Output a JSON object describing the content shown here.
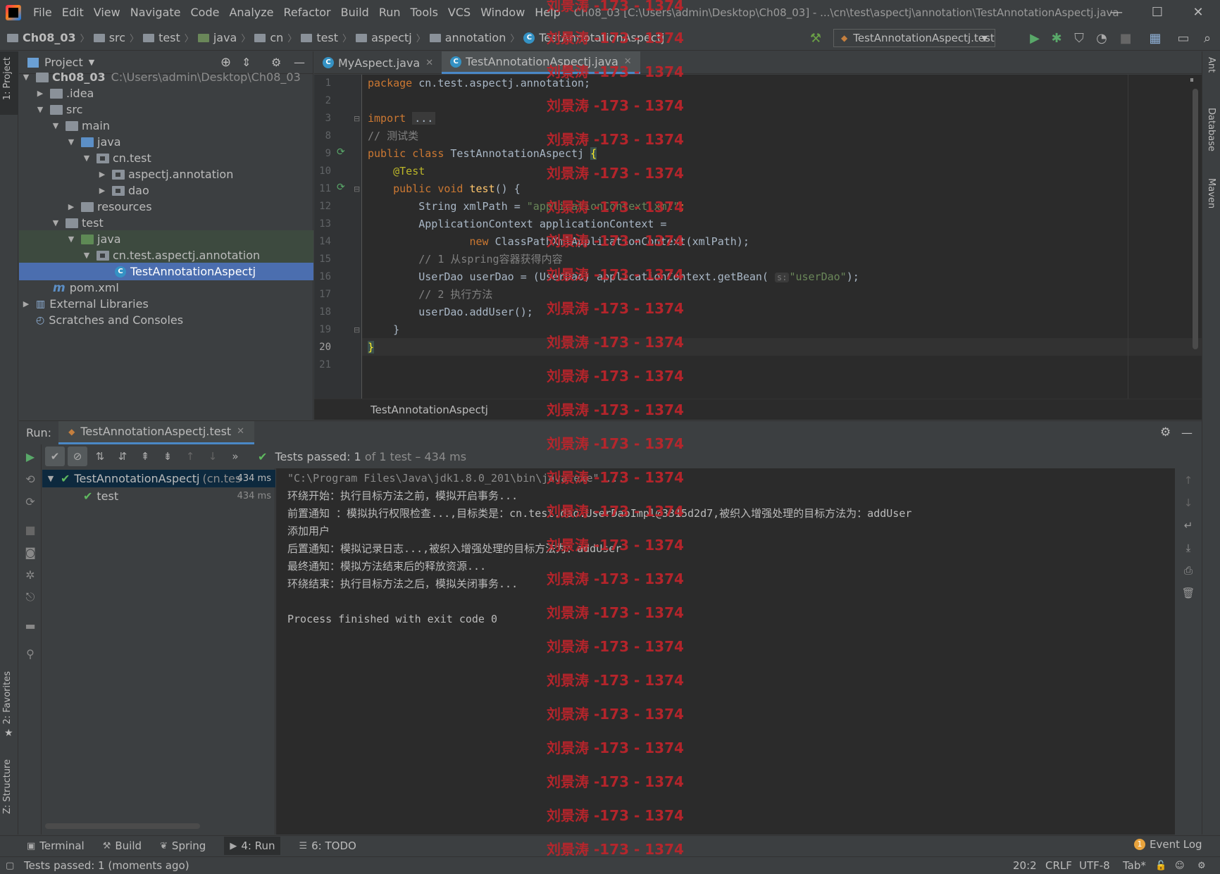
{
  "menu": {
    "items": [
      "File",
      "Edit",
      "View",
      "Navigate",
      "Code",
      "Analyze",
      "Refactor",
      "Build",
      "Run",
      "Tools",
      "VCS",
      "Window",
      "Help"
    ],
    "window_title": "Ch08_03 [C:\\Users\\admin\\Desktop\\Ch08_03] - ...\\cn\\test\\aspectj\\annotation\\TestAnnotationAspectj.java"
  },
  "window_controls": {
    "minimize": "—",
    "maximize": "☐",
    "close": "✕"
  },
  "navbar": {
    "crumbs": [
      "Ch08_03",
      "src",
      "test",
      "java",
      "cn",
      "test",
      "aspectj",
      "annotation",
      "TestAnnotationAspectj"
    ],
    "run_config": "TestAnnotationAspectj.test"
  },
  "left_stripe": {
    "project": "1: Project",
    "favorites": "2: Favorites",
    "structure": "Z: Structure"
  },
  "right_stripe": {
    "ant": "Ant",
    "database": "Database",
    "maven": "Maven"
  },
  "project": {
    "title": "Project",
    "tree": [
      {
        "label": "Ch08_03",
        "hint": "C:\\Users\\admin\\Desktop\\Ch08_03",
        "depth": 0,
        "expanded": true
      },
      {
        "label": ".idea",
        "depth": 1,
        "expanded": false
      },
      {
        "label": "src",
        "depth": 1,
        "expanded": true
      },
      {
        "label": "main",
        "depth": 2,
        "expanded": true
      },
      {
        "label": "java",
        "depth": 3,
        "expanded": true
      },
      {
        "label": "cn.test",
        "depth": 4,
        "expanded": true
      },
      {
        "label": "aspectj.annotation",
        "depth": 5,
        "expanded": false
      },
      {
        "label": "dao",
        "depth": 5,
        "expanded": false
      },
      {
        "label": "resources",
        "depth": 3,
        "expanded": false
      },
      {
        "label": "test",
        "depth": 2,
        "expanded": true
      },
      {
        "label": "java",
        "depth": 3,
        "expanded": true
      },
      {
        "label": "cn.test.aspectj.annotation",
        "depth": 4,
        "expanded": true
      },
      {
        "label": "TestAnnotationAspectj",
        "depth": 5
      },
      {
        "label": "pom.xml",
        "depth": 1
      },
      {
        "label": "External Libraries",
        "depth": 0,
        "expanded": false
      },
      {
        "label": "Scratches and Consoles",
        "depth": 0
      }
    ]
  },
  "editor": {
    "tabs": [
      {
        "label": "MyAspect.java"
      },
      {
        "label": "TestAnnotationAspectj.java"
      }
    ],
    "line_numbers": [
      "1",
      "2",
      "3",
      "8",
      "9",
      "10",
      "11",
      "12",
      "13",
      "14",
      "15",
      "16",
      "17",
      "18",
      "19",
      "20",
      "21"
    ],
    "code": {
      "l1a": "package",
      "l1b": " cn.test.aspectj.annotation;",
      "l3a": "import",
      "l3b": "...",
      "l8": "// 测试类",
      "l9a": "public class",
      "l9b": " TestAnnotationAspectj ",
      "l9c": "{",
      "l10": "    @Test",
      "l11a": "    public void",
      "l11b": "test",
      "l11c": "() {",
      "l12a": "        String xmlPath = ",
      "l12b": "\"applicationContext.xml\"",
      "l12c": ";",
      "l13": "        ApplicationContext applicationContext =",
      "l14a": "                new",
      "l14b": " ClassPathXmlApplicationContext(xmlPath);",
      "l15": "        // 1 从spring容器获得内容",
      "l16a": "        UserDao userDao = (UserDao) applicationContext.getBean(",
      "l16hint": "s:",
      "l16b": "\"userDao\"",
      "l16c": ");",
      "l17": "        // 2 执行方法",
      "l18": "        userDao.addUser();",
      "l19": "    }",
      "l20": "}"
    },
    "breadcrumb": "TestAnnotationAspectj"
  },
  "run": {
    "label": "Run:",
    "tab": "TestAnnotationAspectj.test",
    "status_prefix": "Tests passed: ",
    "status_count": "1",
    "status_suffix": " of 1 test – 434 ms",
    "tree": [
      {
        "label": "TestAnnotationAspectj",
        "hint": "(cn.tes",
        "duration": "434 ms"
      },
      {
        "label": "test",
        "duration": "434 ms"
      }
    ],
    "console": [
      "\"C:\\Program Files\\Java\\jdk1.8.0_201\\bin\\java.exe\" ...",
      "环绕开始：执行目标方法之前，模拟开启事务...",
      "前置通知 ：模拟执行权限检查...,目标类是：cn.test.dao.UserDaoImpl@3315d2d7,被织入增强处理的目标方法为：addUser",
      "添加用户",
      "后置通知：模拟记录日志...,被织入增强处理的目标方法为：addUser",
      "最终通知：模拟方法结束后的释放资源...",
      "环绕结束：执行目标方法之后，模拟关闭事务...",
      "",
      "Process finished with exit code 0"
    ]
  },
  "bottom_tools": [
    {
      "icon": "terminal-icon",
      "label": "Terminal"
    },
    {
      "icon": "build-icon",
      "label": "Build"
    },
    {
      "icon": "spring-icon",
      "label": "Spring"
    },
    {
      "icon": "run-icon",
      "label": "4: Run"
    },
    {
      "icon": "todo-icon",
      "label": "6: TODO"
    }
  ],
  "event_log": {
    "badge": "1",
    "label": "Event Log"
  },
  "statusbar": {
    "message": "Tests passed: 1 (moments ago)",
    "position": "20:2",
    "line_sep": "CRLF",
    "encoding": "UTF-8",
    "indent": "Tab*"
  },
  "watermark": "刘景涛 -173 - 1374",
  "colors": {
    "accent": "#4a88c7",
    "selection": "#4b6eaf",
    "pass": "#5fb85f",
    "watermark": "#c0242b"
  }
}
